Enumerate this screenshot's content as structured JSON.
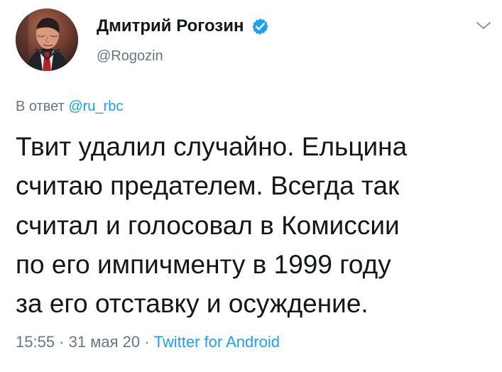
{
  "author": {
    "display_name": "Дмитрий Рогозин",
    "handle": "@Rogozin",
    "verified_icon": "verified-badge-icon"
  },
  "reply": {
    "prefix": "В ответ ",
    "target": "@ru_rbc"
  },
  "tweet": {
    "lines": [
      "Твит удалил случайно. Ельцина",
      "считаю предателем. Всегда так",
      "считал и голосовал в Комиссии",
      "по его импичменту в 1999 году",
      "за его отставку и осуждение."
    ]
  },
  "meta": {
    "time": "15:55",
    "separator_1": " · ",
    "date": "31 мая 20",
    "separator_2": " · ",
    "source": "Twitter for Android"
  },
  "colors": {
    "text_primary": "#14171a",
    "text_secondary": "#657786",
    "link": "#1da1f2",
    "verified": "#1da1f2",
    "background": "#ffffff"
  },
  "icons": {
    "menu": "chevron-down-icon",
    "verified": "verified-badge-icon"
  }
}
